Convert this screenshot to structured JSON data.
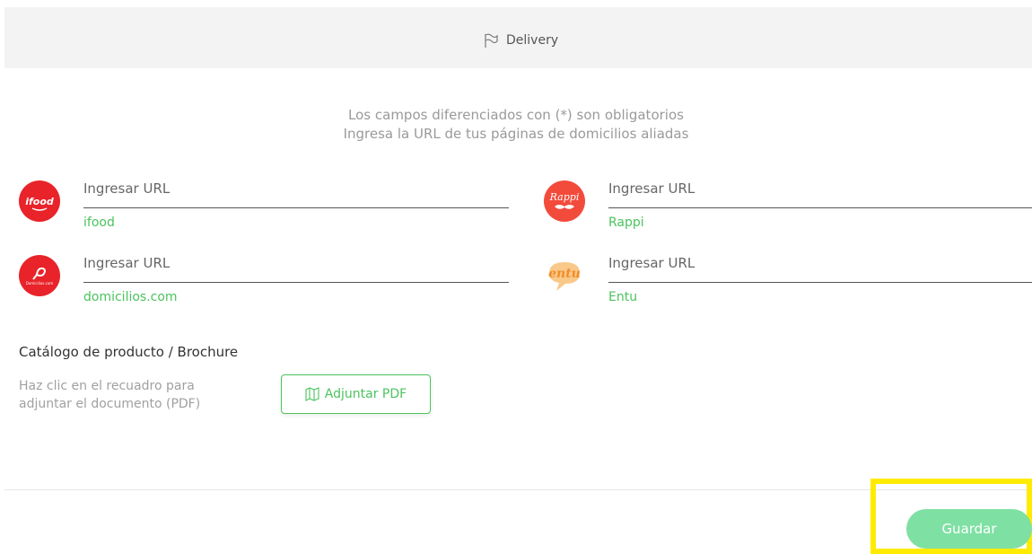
{
  "header": {
    "title": "Delivery",
    "icon": "flag-icon"
  },
  "intro": {
    "line1": "Los campos diferenciados con (*) son obligatorios",
    "line2": "Ingresa la URL de tus páginas de domicilios aliadas"
  },
  "services": [
    {
      "label": "Ingresar URL",
      "value": "ifood",
      "logo_text": "ifood",
      "color": "#e8232a"
    },
    {
      "label": "Ingresar URL",
      "value": "Rappi",
      "logo_text": "Rappi",
      "color": "#f24b3c"
    },
    {
      "label": "Ingresar URL",
      "value": "domicilios.com",
      "logo_text": "Domicilios.com",
      "color": "#e8232a"
    },
    {
      "label": "Ingresar URL",
      "value": "Entu",
      "logo_text": "entu",
      "color": "#f28c28"
    }
  ],
  "catalog": {
    "title": "Catálogo de producto / Brochure",
    "help": "Haz clic en el recuadro para adjuntar el documento (PDF)",
    "button_label": "Adjuntar PDF",
    "button_icon": "map-icon"
  },
  "footer": {
    "save_label": "Guardar"
  },
  "colors": {
    "accent": "#4cc35e",
    "save_bg": "#7fe0a3",
    "highlight": "#ffeb00",
    "header_bg": "#f3f3f3"
  }
}
